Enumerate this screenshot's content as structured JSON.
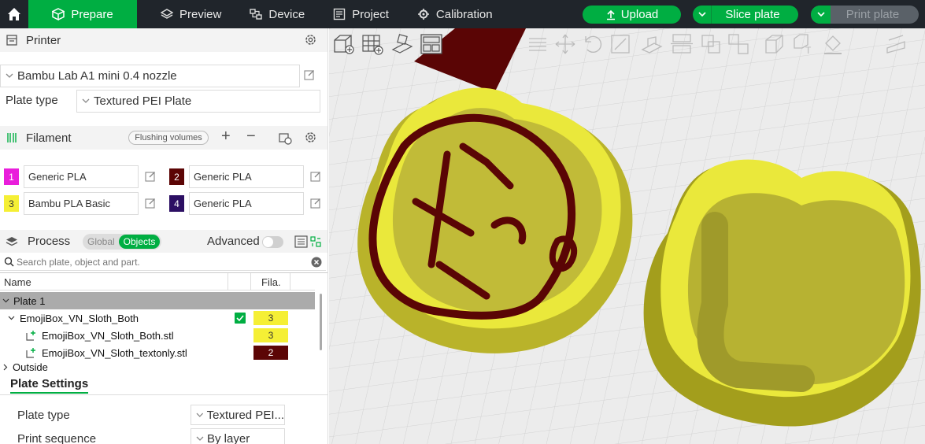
{
  "topbar": {
    "tabs": [
      {
        "label": "Prepare",
        "icon": "cube-icon"
      },
      {
        "label": "Preview",
        "icon": "layers-icon"
      },
      {
        "label": "Device",
        "icon": "device-icon"
      },
      {
        "label": "Project",
        "icon": "project-icon"
      },
      {
        "label": "Calibration",
        "icon": "calibration-icon"
      }
    ],
    "upload": "Upload",
    "slice": "Slice plate",
    "print": "Print plate"
  },
  "printer": {
    "section": "Printer",
    "name": "Bambu Lab A1 mini 0.4 nozzle",
    "plate_type_label": "Plate type",
    "plate_type": "Textured PEI Plate"
  },
  "filament": {
    "section": "Filament",
    "flushing": "Flushing volumes",
    "slots": [
      {
        "num": "1",
        "name": "Generic PLA",
        "color": "#e91edb"
      },
      {
        "num": "2",
        "name": "Generic PLA",
        "color": "#5c0505"
      },
      {
        "num": "3",
        "name": "Bambu PLA Basic",
        "color": "#f5ef35"
      },
      {
        "num": "4",
        "name": "Generic PLA",
        "color": "#2c0f63"
      }
    ]
  },
  "process": {
    "section": "Process",
    "global": "Global",
    "objects": "Objects",
    "advanced": "Advanced",
    "search_placeholder": "Search plate, object and part."
  },
  "tree": {
    "col_name": "Name",
    "col_fila": "Fila.",
    "plate": "Plate 1",
    "object": "EmojiBox_VN_Sloth_Both",
    "object_fil": "3",
    "parts": [
      {
        "name": "EmojiBox_VN_Sloth_Both.stl",
        "fil": "3",
        "color": "#f5ef35",
        "textcolor": "#333333"
      },
      {
        "name": "EmojiBox_VN_Sloth_textonly.stl",
        "fil": "2",
        "color": "#5c0505",
        "textcolor": "#ffffff"
      }
    ],
    "outside": "Outside"
  },
  "plate_settings": {
    "tab": "Plate Settings",
    "plate_type_label": "Plate type",
    "plate_type_value": "Textured PEI...",
    "print_seq_label": "Print sequence",
    "print_seq_value": "By layer"
  }
}
